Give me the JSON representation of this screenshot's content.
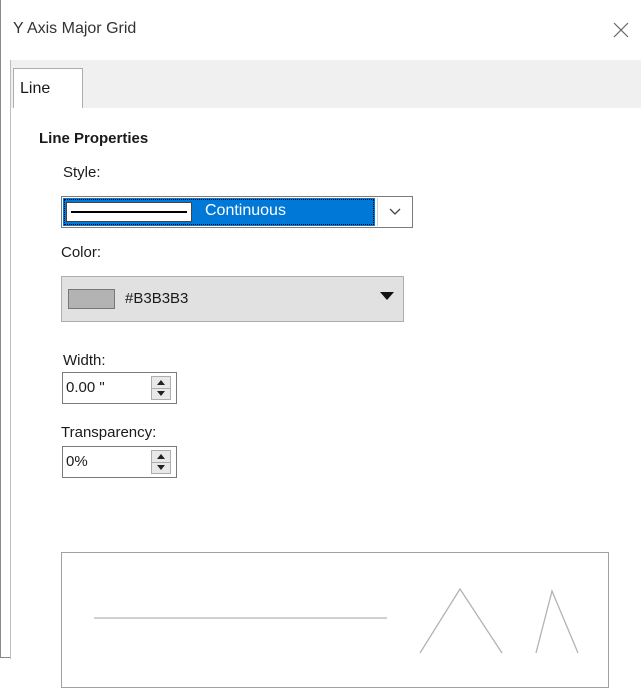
{
  "window": {
    "title": "Y Axis Major Grid"
  },
  "tabs": [
    {
      "label": "Line",
      "selected": true
    }
  ],
  "line_properties": {
    "section_title": "Line Properties",
    "style": {
      "label": "Style:",
      "value": "Continuous"
    },
    "color": {
      "label": "Color:",
      "value": "#B3B3B3",
      "swatch": "#B3B3B3"
    },
    "width": {
      "label": "Width:",
      "value": "0.00 \""
    },
    "transparency": {
      "label": "Transparency:",
      "value": "0%"
    }
  },
  "icons": {
    "close": "close-icon",
    "dropdown": "chevron-down-icon",
    "color_dropdown": "triangle-down-icon",
    "spin_up": "spin-up-icon",
    "spin_down": "spin-down-icon"
  },
  "colors": {
    "selection": "#0078d7",
    "dialog_background": "#f0f0f0",
    "preview_line": "#B3B3B3"
  }
}
